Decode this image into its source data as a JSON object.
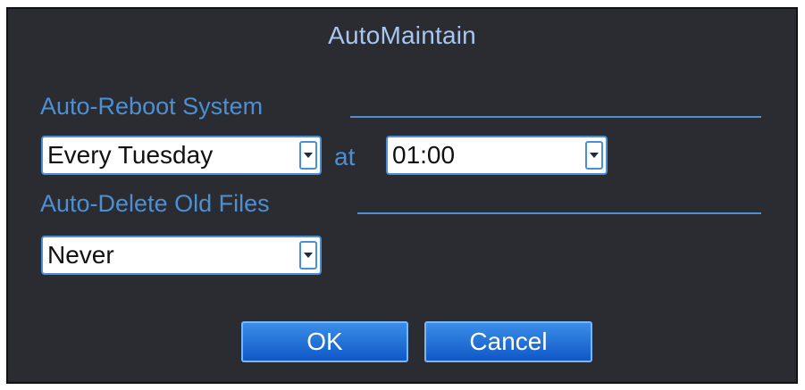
{
  "dialog": {
    "title": "AutoMaintain",
    "auto_reboot": {
      "label": "Auto-Reboot System",
      "day_value": "Every Tuesday",
      "at_label": "at",
      "time_value": "01:00"
    },
    "auto_delete": {
      "label": "Auto-Delete Old Files",
      "value": "Never"
    },
    "buttons": {
      "ok": "OK",
      "cancel": "Cancel"
    }
  },
  "colors": {
    "background": "#2a2c31",
    "title_text": "#a9c6f0",
    "section_text": "#4d8fd0",
    "button_blue": "#1f6fd9"
  },
  "icons": {
    "dropdown": "chevron-down-icon"
  }
}
